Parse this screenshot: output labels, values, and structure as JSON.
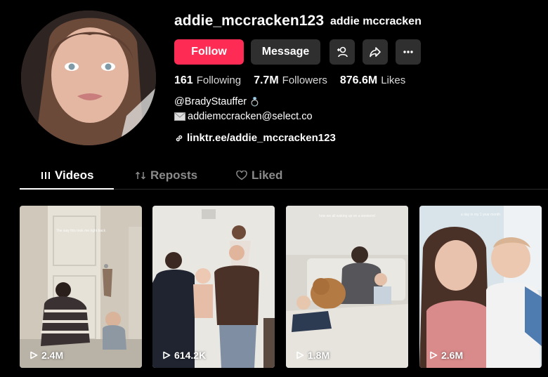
{
  "profile": {
    "username": "addie_mccracken123",
    "display_name": "addie mccracken",
    "follow_label": "Follow",
    "message_label": "Message",
    "stats": [
      {
        "value": "161",
        "label": "Following"
      },
      {
        "value": "7.7M",
        "label": "Followers"
      },
      {
        "value": "876.6M",
        "label": "Likes"
      }
    ],
    "bio_line1": "@BradyStauffer",
    "bio_ring_glyph": "💍",
    "bio_email": "addiemccracken@select.co",
    "link": "linktr.ee/addie_mccracken123"
  },
  "tabs": [
    {
      "label": "Videos",
      "icon": "grid-icon",
      "active": true
    },
    {
      "label": "Reposts",
      "icon": "repost-icon",
      "active": false
    },
    {
      "label": "Liked",
      "icon": "heart-icon",
      "active": false
    }
  ],
  "videos": [
    {
      "views": "2.4M",
      "caption": "The way this took me right back"
    },
    {
      "views": "614.2K",
      "caption": ""
    },
    {
      "views": "1.8M",
      "caption": "how we all waking up on a weekend"
    },
    {
      "views": "2.6M",
      "caption": "a day in my 1 year month"
    }
  ],
  "colors": {
    "accent": "#fe2c55",
    "button_bg": "#2f2f2f",
    "background": "#000000"
  }
}
